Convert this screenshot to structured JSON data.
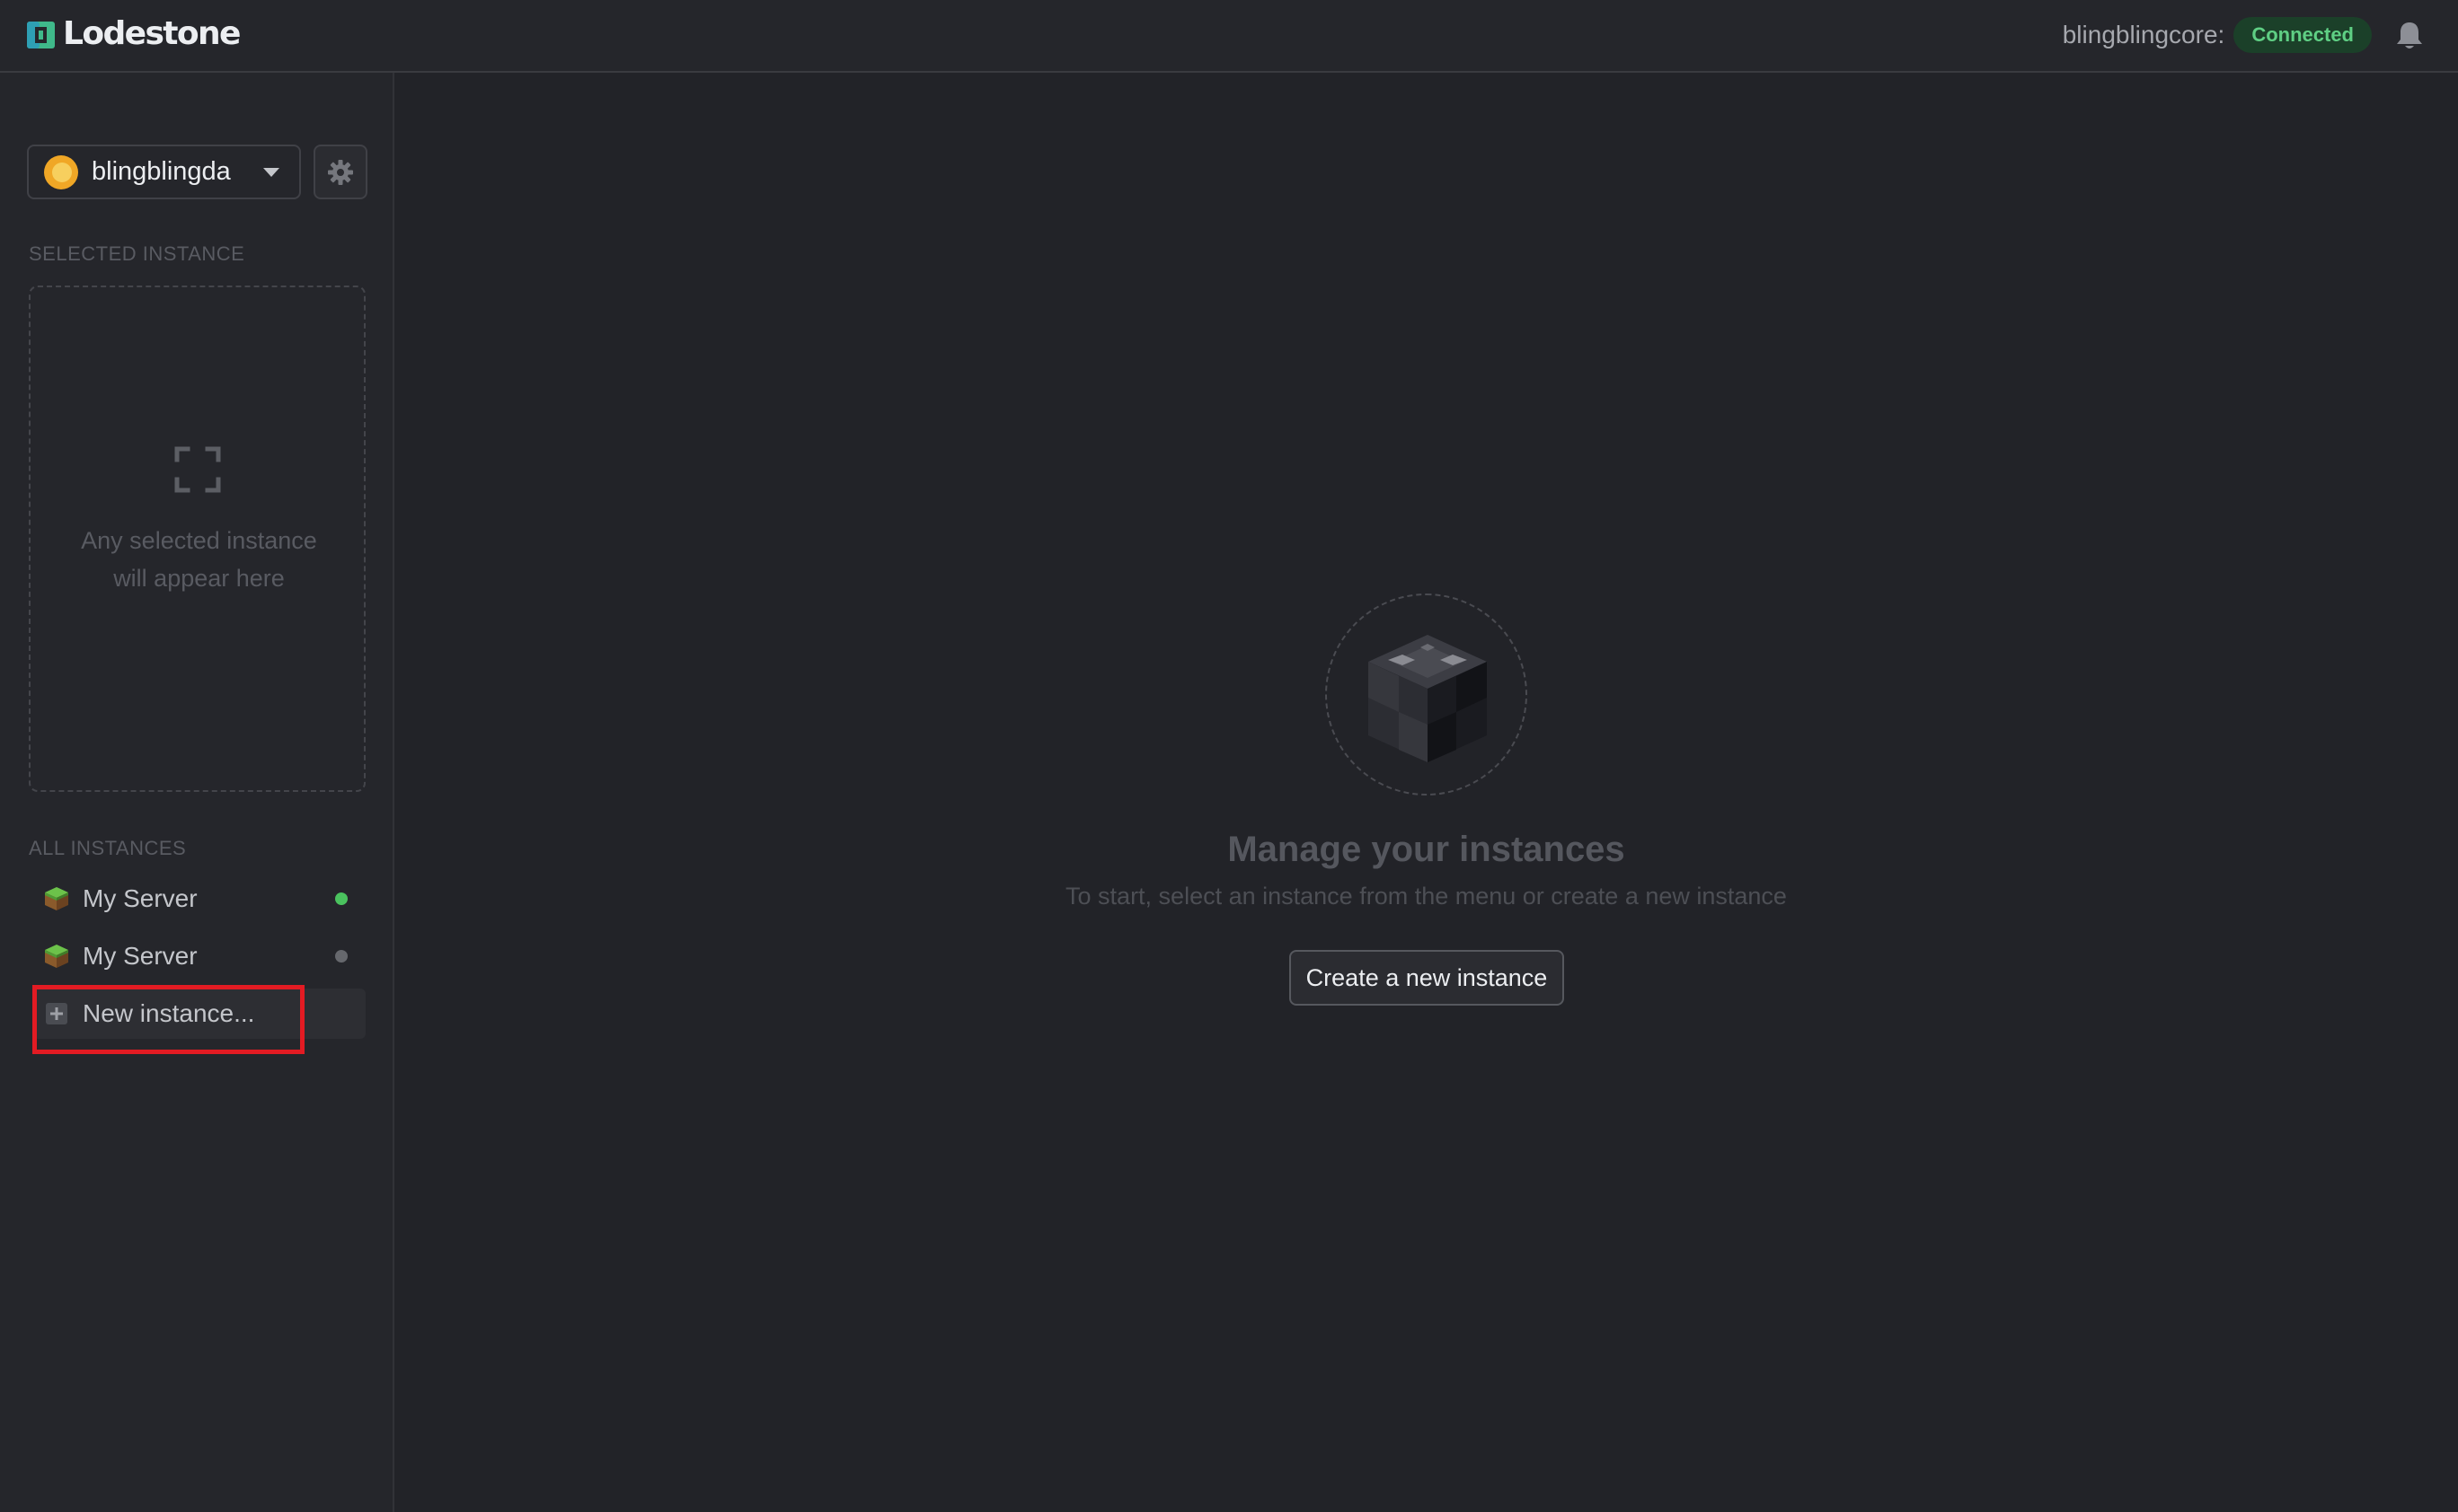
{
  "app": {
    "brand_name": "Lodestone"
  },
  "header": {
    "core_name": "blingblingcore:",
    "connection_status": "Connected",
    "status_color": "#5fcf84",
    "notification_icon": "bell-icon"
  },
  "sidebar": {
    "user": {
      "name": "blingblingda",
      "avatar_color": "#f0a726"
    },
    "settings_icon": "gear-icon",
    "selected_section_label": "SELECTED INSTANCE",
    "selected_placeholder": "Any selected instance will appear here",
    "all_section_label": "ALL INSTANCES",
    "instances": [
      {
        "name": "My Server",
        "status_color": "#4ac25e",
        "status": "running"
      },
      {
        "name": "My Server",
        "status_color": "#66686d",
        "status": "stopped"
      }
    ],
    "new_instance_label": "New instance..."
  },
  "main": {
    "empty_title": "Manage your instances",
    "empty_subtitle": "To start, select an instance from the menu or create a new instance",
    "create_button_label": "Create a new instance"
  },
  "accent_colors": {
    "highlight": "#e31b23",
    "brand_green": "#41b883"
  }
}
